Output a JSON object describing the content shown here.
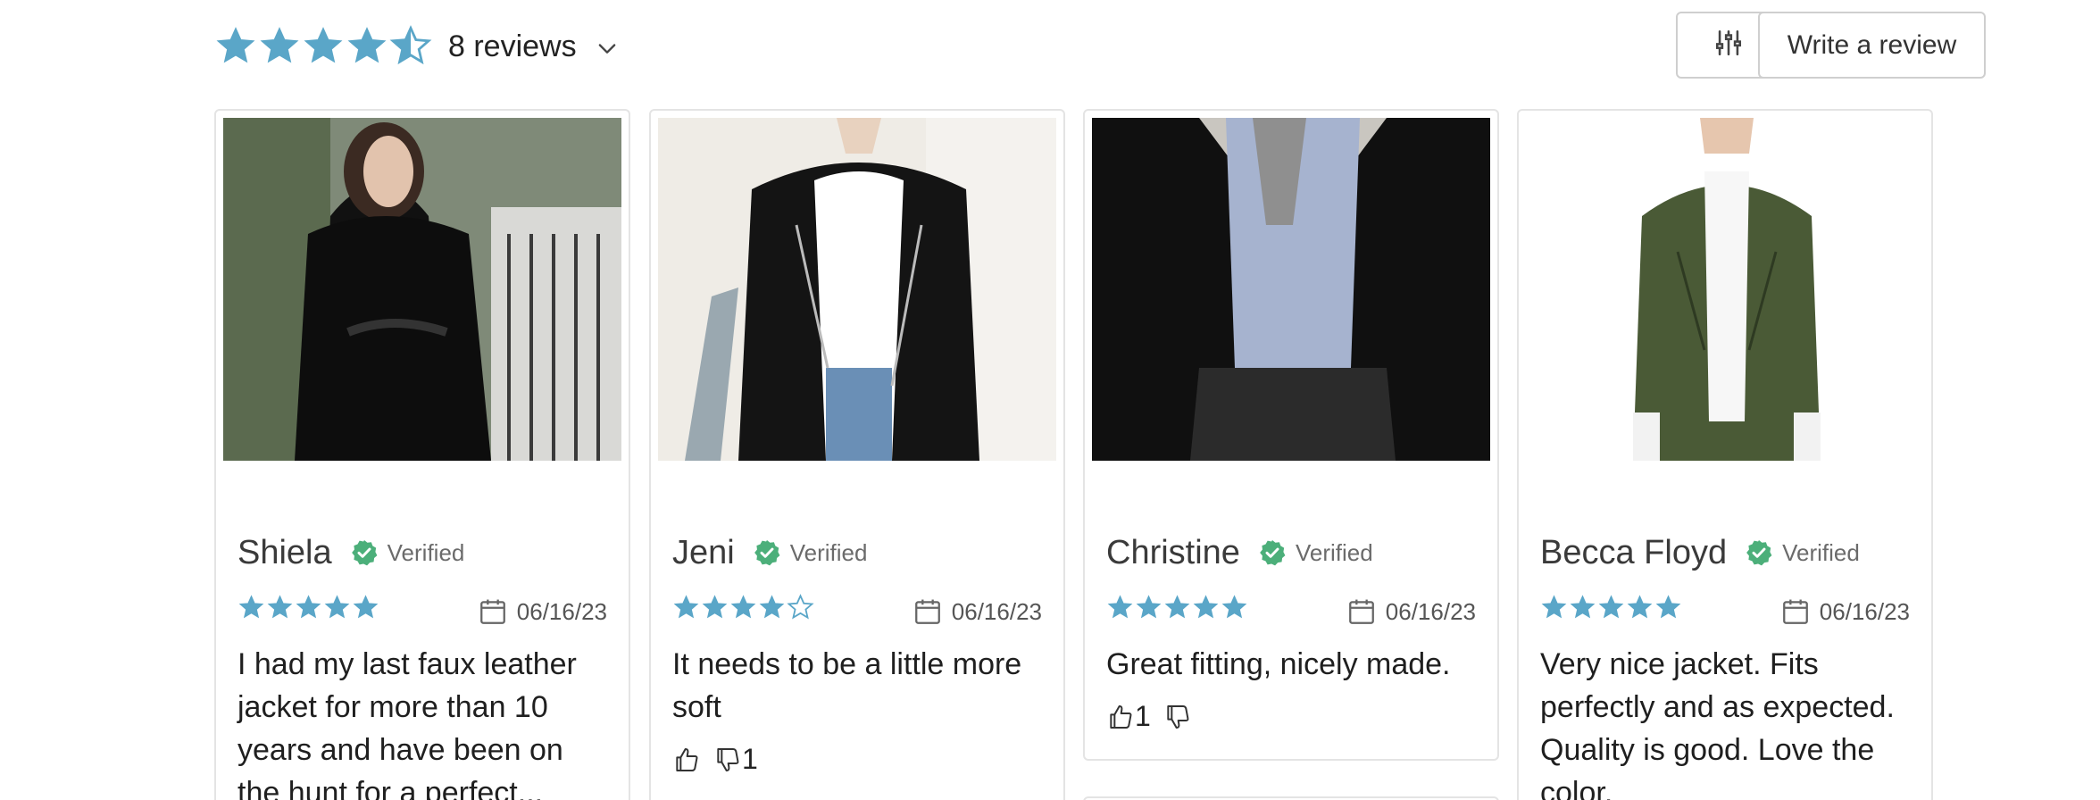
{
  "summary": {
    "rating": 4.5,
    "reviews_label": "8 reviews",
    "star_color": "#5aa6c8",
    "icons": [
      "star-full",
      "star-half",
      "chevron-down-icon",
      "filter-sliders-icon"
    ]
  },
  "actions": {
    "write_review_label": "Write a review"
  },
  "reviews": [
    {
      "name": "Shiela",
      "verified_label": "Verified",
      "rating": 5,
      "date": "06/16/23",
      "text": "I had my last faux leather jacket for more than 10 years and have been on the hunt for a perfect...",
      "photo": "woman in black leather jacket on street"
    },
    {
      "name": "Jeni",
      "verified_label": "Verified",
      "rating": 4,
      "date": "06/16/23",
      "text": "It needs to be a little more soft",
      "helpful_up": "",
      "helpful_down": "1",
      "photo": "black leather jacket with white tee"
    },
    {
      "name": "Christine",
      "verified_label": "Verified",
      "rating": 5,
      "date": "06/16/23",
      "text": "Great fitting, nicely made.",
      "helpful_up": "1",
      "helpful_down": "",
      "photo": "black jacket over striped shirt"
    },
    {
      "name": "Becca Floyd",
      "verified_label": "Verified",
      "rating": 5,
      "date": "06/16/23",
      "text": "Very nice jacket. Fits perfectly and as expected. Quality is good. Love the color.",
      "photo": "olive green leather jacket"
    }
  ],
  "colors": {
    "verified": "#4caf7a",
    "border": "#e4e4e4"
  }
}
